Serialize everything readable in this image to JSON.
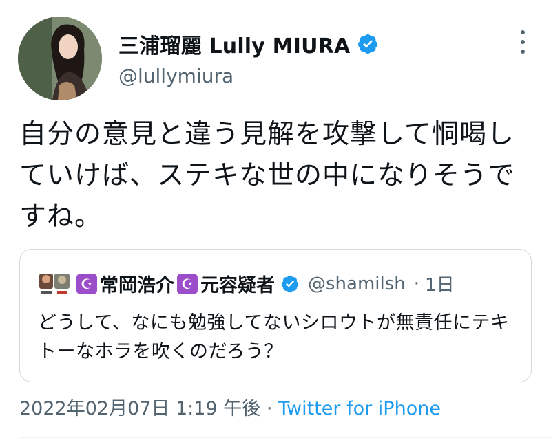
{
  "author": {
    "display_name": "三浦瑠麗 Lully MIURA",
    "handle": "@lullymiura",
    "verified": true,
    "verified_icon": "verified-badge-icon"
  },
  "tweet": {
    "text": "自分の意見と違う見解を攻撃して恫喝していけば、ステキな世の中になりそうですね。"
  },
  "quoted_tweet": {
    "display_name_part1": "常岡浩介",
    "display_name_part2": "元容疑者",
    "name_emoji": "☪",
    "verified": true,
    "handle": "@shamilsh",
    "separator": "·",
    "time_ago": "1日",
    "text": "どうして、なにも勉強してないシロウトが無責任にテキトーなホラを吹くのだろう？"
  },
  "meta": {
    "datetime": "2022年02月07日 1:19 午後",
    "separator": "·",
    "source": "Twitter for iPhone"
  },
  "colors": {
    "link": "#1d9bf0",
    "secondary_text": "#536471",
    "border": "#cfd9de"
  }
}
